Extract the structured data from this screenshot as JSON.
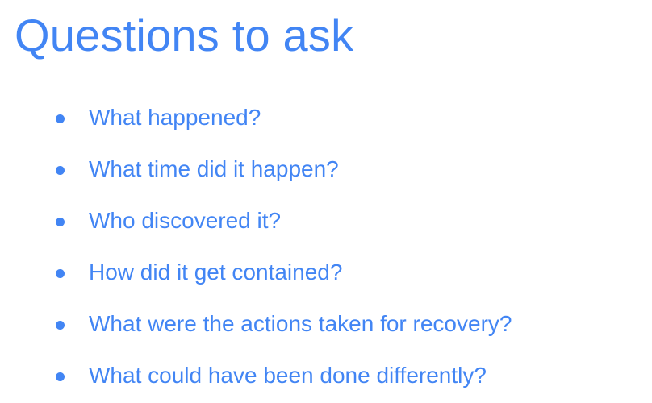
{
  "slide": {
    "title": "Questions to ask",
    "bullets": [
      "What happened?",
      "What time did it happen?",
      "Who discovered it?",
      "How did it get contained?",
      "What were the actions taken for recovery?",
      "What could have been done differently?"
    ],
    "accent_color": "#4285f4"
  }
}
